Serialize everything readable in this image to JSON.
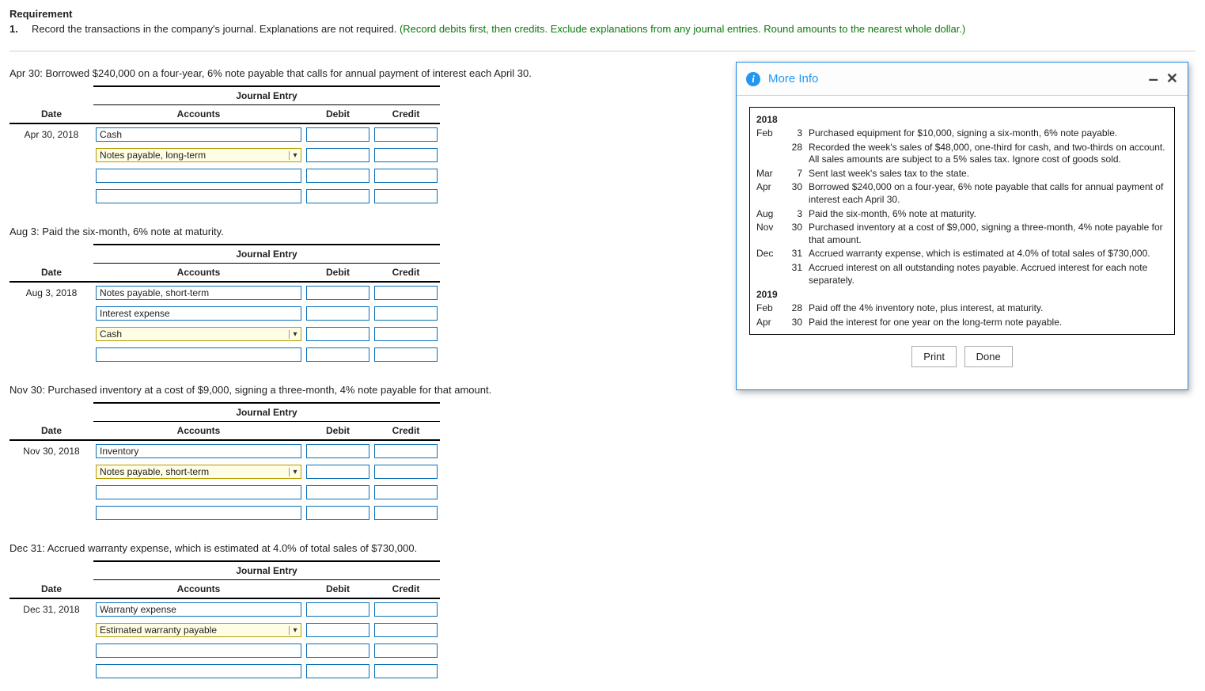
{
  "header": {
    "title": "Requirement",
    "num": "1.",
    "text": "Record the transactions in the company's journal. Explanations are not required. ",
    "green": "(Record debits first, then credits. Exclude explanations from any journal entries. Round amounts to the nearest whole dollar.)"
  },
  "table_headers": {
    "title": "Journal Entry",
    "date": "Date",
    "accounts": "Accounts",
    "debit": "Debit",
    "credit": "Credit"
  },
  "entries": [
    {
      "instr": "Apr 30: Borrowed $240,000 on a four-year, 6% note payable that calls for annual payment of interest each April 30.",
      "date": "Apr 30, 2018",
      "rows": [
        {
          "acct": "Cash",
          "hl": false,
          "arrow": false
        },
        {
          "acct": "Notes payable, long-term",
          "hl": true,
          "arrow": true
        },
        {
          "acct": "",
          "hl": false,
          "arrow": false
        },
        {
          "acct": "",
          "hl": false,
          "arrow": false
        }
      ]
    },
    {
      "instr": "Aug 3: Paid the six-month, 6% note at maturity.",
      "date": "Aug 3, 2018",
      "rows": [
        {
          "acct": "Notes payable, short-term",
          "hl": false,
          "arrow": false
        },
        {
          "acct": "Interest expense",
          "hl": false,
          "arrow": false
        },
        {
          "acct": "Cash",
          "hl": true,
          "arrow": true
        },
        {
          "acct": "",
          "hl": false,
          "arrow": false
        }
      ]
    },
    {
      "instr": "Nov 30: Purchased inventory at a cost of $9,000, signing a three-month, 4% note payable for that amount.",
      "date": "Nov 30, 2018",
      "rows": [
        {
          "acct": "Inventory",
          "hl": false,
          "arrow": false
        },
        {
          "acct": "Notes payable, short-term",
          "hl": true,
          "arrow": true
        },
        {
          "acct": "",
          "hl": false,
          "arrow": false
        },
        {
          "acct": "",
          "hl": false,
          "arrow": false
        }
      ]
    },
    {
      "instr": "Dec 31: Accrued warranty expense, which is estimated at 4.0% of total sales of $730,000.",
      "date": "Dec 31, 2018",
      "rows": [
        {
          "acct": "Warranty expense",
          "hl": false,
          "arrow": false
        },
        {
          "acct": "Estimated warranty payable",
          "hl": true,
          "arrow": true
        },
        {
          "acct": "",
          "hl": false,
          "arrow": false
        },
        {
          "acct": "",
          "hl": false,
          "arrow": false
        }
      ]
    }
  ],
  "modal": {
    "title": "More Info",
    "years": [
      "2018",
      "2019"
    ],
    "items_2018": [
      {
        "mon": "Feb",
        "day": "3",
        "txt": "Purchased equipment for $10,000, signing a six-month, 6% note payable."
      },
      {
        "mon": "",
        "day": "28",
        "txt": "Recorded the week's sales of $48,000, one-third for cash, and two-thirds on account. All sales amounts are subject to a 5% sales tax. Ignore cost of goods sold."
      },
      {
        "mon": "Mar",
        "day": "7",
        "txt": "Sent last week's sales tax to the state."
      },
      {
        "mon": "Apr",
        "day": "30",
        "txt": "Borrowed $240,000 on a four-year, 6% note payable that calls for annual payment of interest each April 30."
      },
      {
        "mon": "Aug",
        "day": "3",
        "txt": "Paid the six-month, 6% note at maturity."
      },
      {
        "mon": "Nov",
        "day": "30",
        "txt": "Purchased inventory at a cost of $9,000, signing a three-month, 4% note payable for that amount."
      },
      {
        "mon": "Dec",
        "day": "31",
        "txt": "Accrued warranty expense, which is estimated at 4.0% of total sales of $730,000."
      },
      {
        "mon": "",
        "day": "31",
        "txt": "Accrued interest on all outstanding notes payable. Accrued interest for each note separately."
      }
    ],
    "items_2019": [
      {
        "mon": "Feb",
        "day": "28",
        "txt": "Paid off the 4% inventory note, plus interest, at maturity."
      },
      {
        "mon": "Apr",
        "day": "30",
        "txt": "Paid the interest for one year on the long-term note payable."
      }
    ],
    "print": "Print",
    "done": "Done"
  }
}
